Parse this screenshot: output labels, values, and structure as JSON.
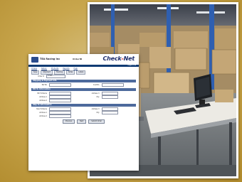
{
  "form": {
    "company_name": "TEA Racing Inc",
    "window_title": "OrderID",
    "brand": {
      "part1": "Check",
      "part2": "Net"
    },
    "topbar_text": "Logged in ▪",
    "nav": [
      "Orders",
      "Return",
      "Products",
      "Reports",
      "Help"
    ],
    "toolbar": [
      "Save",
      "Shipment",
      "Tracking",
      "Notes",
      "Labels"
    ],
    "order_row": {
      "label": "Order #",
      "value": "12345"
    },
    "sections": {
      "general": "Shipping & Payment Info",
      "bill_to": "Bill To Information",
      "ship_to": "Ship To Information"
    },
    "general_fields": [
      {
        "label": "Ref No",
        "value": ""
      },
      {
        "label": "Cust No",
        "value": ""
      }
    ],
    "bill_fields": [
      {
        "label": "Bill To Name",
        "value": ""
      },
      {
        "label": "Address 1",
        "value": ""
      },
      {
        "label": "Address 2",
        "value": ""
      },
      {
        "label": "Address 3",
        "value": ""
      },
      {
        "label": "City",
        "value": ""
      }
    ],
    "ship_fields": [
      {
        "label": "Ship To Name",
        "value": ""
      },
      {
        "label": "Address 1",
        "value": ""
      },
      {
        "label": "Address 2",
        "value": ""
      },
      {
        "label": "Address 3",
        "value": ""
      },
      {
        "label": "City",
        "value": ""
      }
    ],
    "bottom_buttons": [
      "Previous",
      "Next",
      "Submit Order"
    ]
  }
}
